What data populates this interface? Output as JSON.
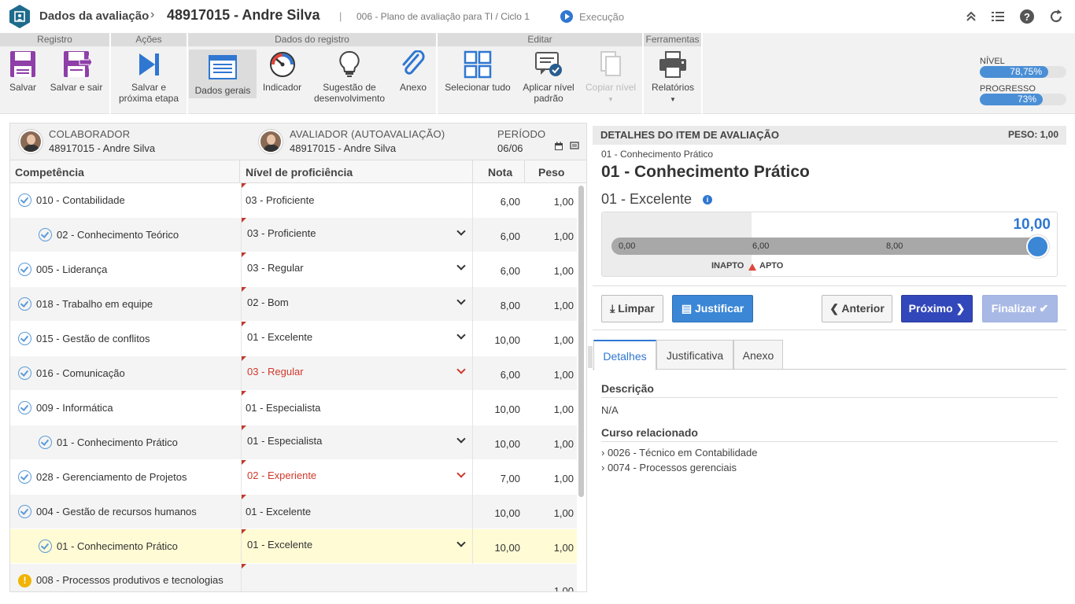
{
  "topbar": {
    "breadcrumb_root": "Dados da avaliação",
    "breadcrumb_sep": "›",
    "record_title": "48917015 - Andre Silva",
    "pipe": "|",
    "plan": "006 - Plano de avaliação para TI / Ciclo 1",
    "status": "Execução"
  },
  "ribbon": {
    "groups": {
      "registro": "Registro",
      "acoes": "Ações",
      "dados": "Dados do registro",
      "editar": "Editar",
      "ferramentas": "Ferramentas"
    },
    "buttons": {
      "salvar": "Salvar",
      "salvar_sair": "Salvar e sair",
      "salvar_prox_1": "Salvar e",
      "salvar_prox_2": "próxima etapa",
      "dados_gerais": "Dados gerais",
      "indicador": "Indicador",
      "sugestao_1": "Sugestão de",
      "sugestao_2": "desenvolvimento",
      "anexo": "Anexo",
      "selecionar": "Selecionar tudo",
      "aplicar_1": "Aplicar nível",
      "aplicar_2": "padrão",
      "copiar": "Copiar nível",
      "relatorios": "Relatórios"
    },
    "meters": {
      "nivel_label": "NÍVEL",
      "nivel_value": "78,75%",
      "nivel_fraction": 0.7875,
      "progresso_label": "PROGRESSO",
      "progresso_value": "73%",
      "progresso_fraction": 0.73
    },
    "colors": {
      "purple": "#8e3fa8",
      "blue": "#2f77d1"
    }
  },
  "header": {
    "colaborador_label": "COLABORADOR",
    "colaborador_value": "48917015 - Andre Silva",
    "avaliador_label": "AVALIADOR (AUTOAVALIAÇÃO)",
    "avaliador_value": "48917015 - Andre Silva",
    "periodo_label": "PERÍODO",
    "periodo_value": "06/06"
  },
  "table": {
    "columns": [
      "Competência",
      "Nível de proficiência",
      "Nota",
      "Peso"
    ],
    "rows": [
      {
        "competencia": "010 - Contabilidade",
        "nivel": "03 - Proficiente",
        "nota": "6,00",
        "peso": "1,00"
      },
      {
        "competencia": "02 - Conhecimento Teórico",
        "nivel": "03 - Proficiente",
        "nota": "6,00",
        "peso": "1,00"
      },
      {
        "competencia": "005 - Liderança",
        "nivel": "03 - Regular",
        "nota": "6,00",
        "peso": "1,00"
      },
      {
        "competencia": "018 - Trabalho em equipe",
        "nivel": "02 - Bom",
        "nota": "8,00",
        "peso": "1,00"
      },
      {
        "competencia": "015 - Gestão de conflitos",
        "nivel": "01 - Excelente",
        "nota": "10,00",
        "peso": "1,00"
      },
      {
        "competencia": "016 - Comunicação",
        "nivel": "03 - Regular",
        "nota": "6,00",
        "peso": "1,00"
      },
      {
        "competencia": "009 - Informática",
        "nivel": "01 - Especialista",
        "nota": "10,00",
        "peso": "1,00"
      },
      {
        "competencia": "01 - Conhecimento Prático",
        "nivel": "01 - Especialista",
        "nota": "10,00",
        "peso": "1,00"
      },
      {
        "competencia": "028 - Gerenciamento de Projetos",
        "nivel": "02 - Experiente",
        "nota": "7,00",
        "peso": "1,00"
      },
      {
        "competencia": "004 - Gestão de recursos humanos",
        "nivel": "01 - Excelente",
        "nota": "10,00",
        "peso": "1,00"
      },
      {
        "competencia": "01 - Conhecimento Prático",
        "nivel": "01 - Excelente",
        "nota": "10,00",
        "peso": "1,00"
      },
      {
        "competencia": "008 - Processos produtivos e tecnologias",
        "nivel": "",
        "nota": "",
        "peso": "1,00"
      }
    ]
  },
  "detail": {
    "header_title": "DETALHES DO ITEM DE AVALIAÇÃO",
    "peso": "PESO: 1,00",
    "small": "01 - Conhecimento Prático",
    "title": "01 - Conhecimento Prático",
    "level": "01 - Excelente",
    "info": "i",
    "score": "10,00",
    "ticks": [
      "0,00",
      "6,00",
      "8,00"
    ],
    "inapto": "INAPTO",
    "apto": "APTO",
    "buttons": {
      "limpar": "Limpar",
      "justificar": "Justificar",
      "anterior": "Anterior",
      "proximo": "Próximo",
      "finalizar": "Finalizar"
    },
    "tabs": [
      "Detalhes",
      "Justificativa",
      "Anexo"
    ],
    "descricao_title": "Descrição",
    "descricao": "N/A",
    "curso_title": "Curso relacionado",
    "cursos": [
      "› 0026 - Técnico em Contabilidade",
      "› 0074 - Processos gerenciais"
    ]
  }
}
